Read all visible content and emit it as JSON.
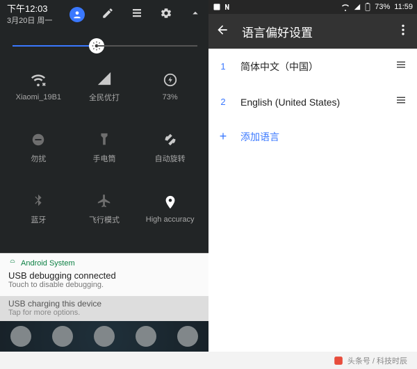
{
  "left": {
    "status": {
      "time": "下午12:03",
      "date": "3月20日 周一"
    },
    "brightness": {
      "percent": 46
    },
    "tiles": [
      {
        "label": "Xiaomi_19B1",
        "icon": "wifi-off-icon"
      },
      {
        "label": "全民优打",
        "icon": "signal-icon"
      },
      {
        "label": "73%",
        "icon": "battery-circle-icon"
      },
      {
        "label": "勿扰",
        "icon": "dnd-icon"
      },
      {
        "label": "手电筒",
        "icon": "flashlight-icon"
      },
      {
        "label": "自动旋转",
        "icon": "rotate-icon"
      },
      {
        "label": "蓝牙",
        "icon": "bluetooth-icon"
      },
      {
        "label": "飞行模式",
        "icon": "airplane-icon"
      },
      {
        "label": "High accuracy",
        "icon": "location-icon"
      }
    ],
    "notif1": {
      "header": "Android System",
      "title": "USB debugging connected",
      "desc": "Touch to disable debugging."
    },
    "notif2": {
      "title": "USB charging this device",
      "desc": "Tap for more options."
    }
  },
  "right": {
    "status": {
      "battery": "73%",
      "time": "11:59"
    },
    "appbar": {
      "title": "语言偏好设置"
    },
    "languages": [
      {
        "index": "1",
        "name": "简体中文（中国）"
      },
      {
        "index": "2",
        "name": "English (United States)"
      }
    ],
    "add_label": "添加语言"
  },
  "footer": {
    "text": "头条号 / 科技时辰"
  }
}
